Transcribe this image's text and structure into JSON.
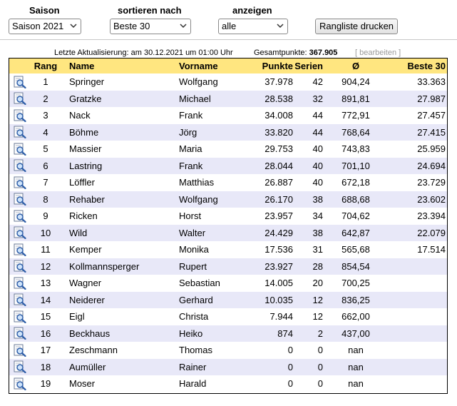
{
  "filters": {
    "saison_label": "Saison",
    "saison_value": "Saison 2021",
    "sort_label": "sortieren nach",
    "sort_value": "Beste 30",
    "show_label": "anzeigen",
    "show_value": "alle",
    "print_button": "Rangliste drucken"
  },
  "info": {
    "last_update": "Letzte Aktualisierung: am 30.12.2021 um 01:00 Uhr",
    "total_label": "Gesamtpunkte:",
    "total_value": "367.905",
    "edit_link": "[ bearbeiten ]"
  },
  "table": {
    "headers": {
      "rang": "Rang",
      "name": "Name",
      "vorname": "Vorname",
      "punkte": "Punkte",
      "serien": "Serien",
      "avg": "Ø",
      "best": "Beste 30"
    },
    "row_icon": "magnifier-detail-icon",
    "rows": [
      {
        "rang": "1",
        "name": "Springer",
        "vorname": "Wolfgang",
        "punkte": "37.978",
        "serien": "42",
        "avg": "904,24",
        "best": "33.363"
      },
      {
        "rang": "2",
        "name": "Gratzke",
        "vorname": "Michael",
        "punkte": "28.538",
        "serien": "32",
        "avg": "891,81",
        "best": "27.987"
      },
      {
        "rang": "3",
        "name": "Nack",
        "vorname": "Frank",
        "punkte": "34.008",
        "serien": "44",
        "avg": "772,91",
        "best": "27.457"
      },
      {
        "rang": "4",
        "name": "Böhme",
        "vorname": "Jörg",
        "punkte": "33.820",
        "serien": "44",
        "avg": "768,64",
        "best": "27.415"
      },
      {
        "rang": "5",
        "name": "Massier",
        "vorname": "Maria",
        "punkte": "29.753",
        "serien": "40",
        "avg": "743,83",
        "best": "25.959"
      },
      {
        "rang": "6",
        "name": "Lastring",
        "vorname": "Frank",
        "punkte": "28.044",
        "serien": "40",
        "avg": "701,10",
        "best": "24.694"
      },
      {
        "rang": "7",
        "name": "Löffler",
        "vorname": "Matthias",
        "punkte": "26.887",
        "serien": "40",
        "avg": "672,18",
        "best": "23.729"
      },
      {
        "rang": "8",
        "name": "Rehaber",
        "vorname": "Wolfgang",
        "punkte": "26.170",
        "serien": "38",
        "avg": "688,68",
        "best": "23.602"
      },
      {
        "rang": "9",
        "name": "Ricken",
        "vorname": "Horst",
        "punkte": "23.957",
        "serien": "34",
        "avg": "704,62",
        "best": "23.394"
      },
      {
        "rang": "10",
        "name": "Wild",
        "vorname": "Walter",
        "punkte": "24.429",
        "serien": "38",
        "avg": "642,87",
        "best": "22.079"
      },
      {
        "rang": "11",
        "name": "Kemper",
        "vorname": "Monika",
        "punkte": "17.536",
        "serien": "31",
        "avg": "565,68",
        "best": "17.514"
      },
      {
        "rang": "12",
        "name": "Kollmannsperger",
        "vorname": "Rupert",
        "punkte": "23.927",
        "serien": "28",
        "avg": "854,54",
        "best": ""
      },
      {
        "rang": "13",
        "name": "Wagner",
        "vorname": "Sebastian",
        "punkte": "14.005",
        "serien": "20",
        "avg": "700,25",
        "best": ""
      },
      {
        "rang": "14",
        "name": "Neiderer",
        "vorname": "Gerhard",
        "punkte": "10.035",
        "serien": "12",
        "avg": "836,25",
        "best": ""
      },
      {
        "rang": "15",
        "name": "Eigl",
        "vorname": "Christa",
        "punkte": "7.944",
        "serien": "12",
        "avg": "662,00",
        "best": ""
      },
      {
        "rang": "16",
        "name": "Beckhaus",
        "vorname": "Heiko",
        "punkte": "874",
        "serien": "2",
        "avg": "437,00",
        "best": ""
      },
      {
        "rang": "17",
        "name": "Zeschmann",
        "vorname": "Thomas",
        "punkte": "0",
        "serien": "0",
        "avg": "nan",
        "best": ""
      },
      {
        "rang": "18",
        "name": "Aumüller",
        "vorname": "Rainer",
        "punkte": "0",
        "serien": "0",
        "avg": "nan",
        "best": ""
      },
      {
        "rang": "19",
        "name": "Moser",
        "vorname": "Harald",
        "punkte": "0",
        "serien": "0",
        "avg": "nan",
        "best": ""
      }
    ]
  },
  "colors": {
    "header_bg": "#ffe680",
    "alt_row_bg": "#e8e8f8",
    "muted_text": "#9a9a9a"
  }
}
